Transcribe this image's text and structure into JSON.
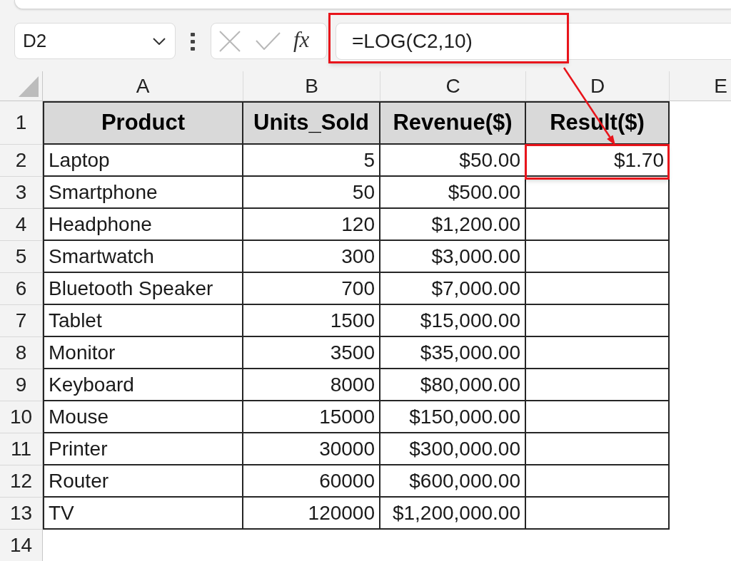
{
  "formula_bar": {
    "name_box": "D2",
    "function_button": "fx",
    "formula": "=LOG(C2,10)"
  },
  "sheet": {
    "columns": [
      {
        "letter": "A",
        "kind": "text"
      },
      {
        "letter": "B",
        "kind": "number"
      },
      {
        "letter": "C",
        "kind": "number"
      },
      {
        "letter": "D",
        "kind": "number"
      },
      {
        "letter": "E"
      }
    ],
    "rows": [
      {
        "number": "1",
        "kind": "header",
        "cells": [
          "Product",
          "Units_Sold",
          "Revenue($)",
          "Result($)"
        ]
      },
      {
        "number": "2",
        "kind": "data",
        "cells": [
          "Laptop",
          "5",
          "$50.00",
          "$1.70"
        ]
      },
      {
        "number": "3",
        "kind": "data",
        "cells": [
          "Smartphone",
          "50",
          "$500.00"
        ]
      },
      {
        "number": "4",
        "kind": "data",
        "cells": [
          "Headphone",
          "120",
          "$1,200.00"
        ]
      },
      {
        "number": "5",
        "kind": "data",
        "cells": [
          "Smartwatch",
          "300",
          "$3,000.00"
        ]
      },
      {
        "number": "6",
        "kind": "data",
        "cells": [
          "Bluetooth Speaker",
          "700",
          "$7,000.00"
        ]
      },
      {
        "number": "7",
        "kind": "data",
        "cells": [
          "Tablet",
          "1500",
          "$15,000.00"
        ]
      },
      {
        "number": "8",
        "kind": "data",
        "cells": [
          "Monitor",
          "3500",
          "$35,000.00"
        ]
      },
      {
        "number": "9",
        "kind": "data",
        "cells": [
          "Keyboard",
          "8000",
          "$80,000.00"
        ]
      },
      {
        "number": "10",
        "kind": "data",
        "cells": [
          "Mouse",
          "15000",
          "$150,000.00"
        ]
      },
      {
        "number": "11",
        "kind": "data",
        "cells": [
          "Printer",
          "30000",
          "$300,000.00"
        ]
      },
      {
        "number": "12",
        "kind": "data",
        "cells": [
          "Router",
          "60000",
          "$600,000.00"
        ]
      },
      {
        "number": "13",
        "kind": "data",
        "cells": [
          "TV",
          "120000",
          "$1,200,000.00"
        ]
      },
      {
        "number": "14",
        "kind": "data"
      }
    ]
  }
}
